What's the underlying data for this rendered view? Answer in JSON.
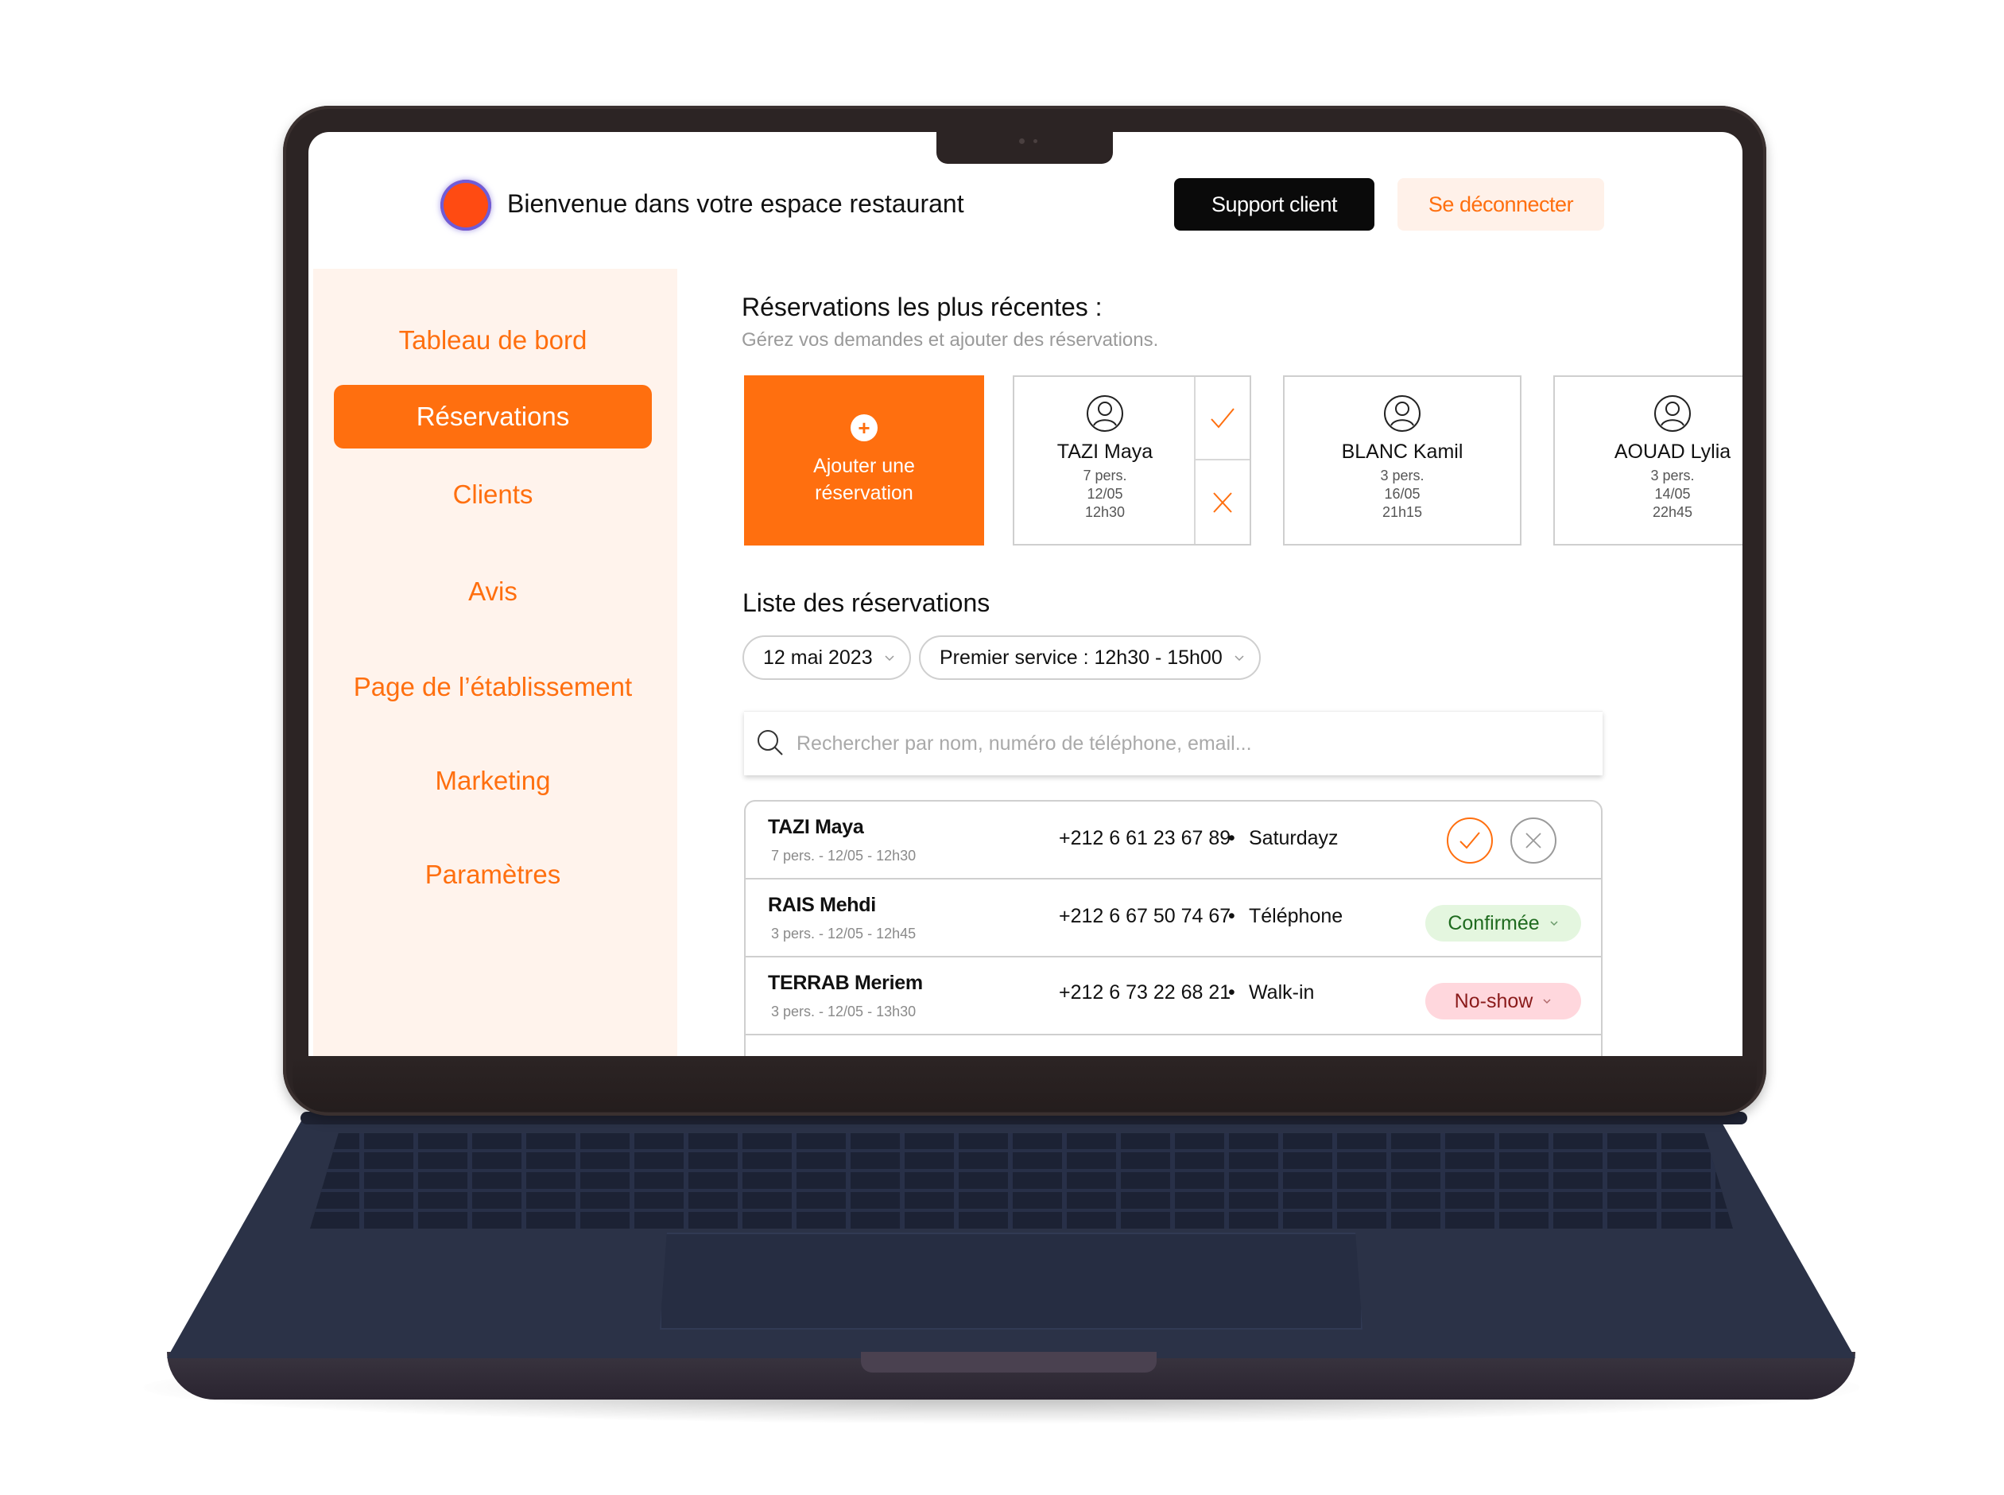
{
  "header": {
    "welcome": "Bienvenue dans votre espace restaurant",
    "support_label": "Support client",
    "logout_label": "Se déconnecter"
  },
  "sidebar": {
    "items": [
      {
        "label": "Tableau de bord",
        "active": false
      },
      {
        "label": "Réservations",
        "active": true
      },
      {
        "label": "Clients",
        "active": false
      },
      {
        "label": "Avis",
        "active": false
      },
      {
        "label": "Page de l’établissement",
        "active": false
      },
      {
        "label": "Marketing",
        "active": false
      },
      {
        "label": "Paramètres",
        "active": false
      }
    ]
  },
  "recent": {
    "title": "Réservations les plus récentes :",
    "subtitle": "Gérez vos demandes et ajouter des réservations.",
    "add_label": "Ajouter une réservation",
    "cards": [
      {
        "name": "TAZI Maya",
        "people": "7 pers.",
        "date": "12/05",
        "time": "12h30"
      },
      {
        "name": "BLANC Kamil",
        "people": "3 pers.",
        "date": "16/05",
        "time": "21h15"
      },
      {
        "name": "AOUAD Lylia",
        "people": "3 pers.",
        "date": "14/05",
        "time": "22h45"
      }
    ]
  },
  "list": {
    "title": "Liste des réservations",
    "date_filter": "12 mai 2023",
    "service_filter": "Premier service : 12h30 - 15h00",
    "search_placeholder": "Rechercher par nom, numéro de téléphone, email...",
    "rows": [
      {
        "name": "TAZI Maya",
        "meta": "7 pers. - 12/05 - 12h30",
        "phone": "+212 6 61 23 67 89",
        "source": "Saturdayz",
        "status": ""
      },
      {
        "name": "RAIS Mehdi",
        "meta": "3 pers. - 12/05 - 12h45",
        "phone": "+212 6 67 50 74 67",
        "source": "Téléphone",
        "status": "Confirmée"
      },
      {
        "name": "TERRAB Meriem",
        "meta": "3 pers. - 12/05 - 13h30",
        "phone": "+212 6 73 22 68 21",
        "source": "Walk-in",
        "status": "No-show"
      }
    ],
    "separator": "•"
  },
  "colors": {
    "accent": "#ff6f0f",
    "sidebar_bg": "#fff3ec",
    "confirmed_bg": "#e4f6df",
    "noshow_bg": "#ffd7dd"
  },
  "icons": [
    "avatar-icon",
    "check-icon",
    "close-icon",
    "plus-icon",
    "search-icon",
    "chevron-down-icon"
  ]
}
